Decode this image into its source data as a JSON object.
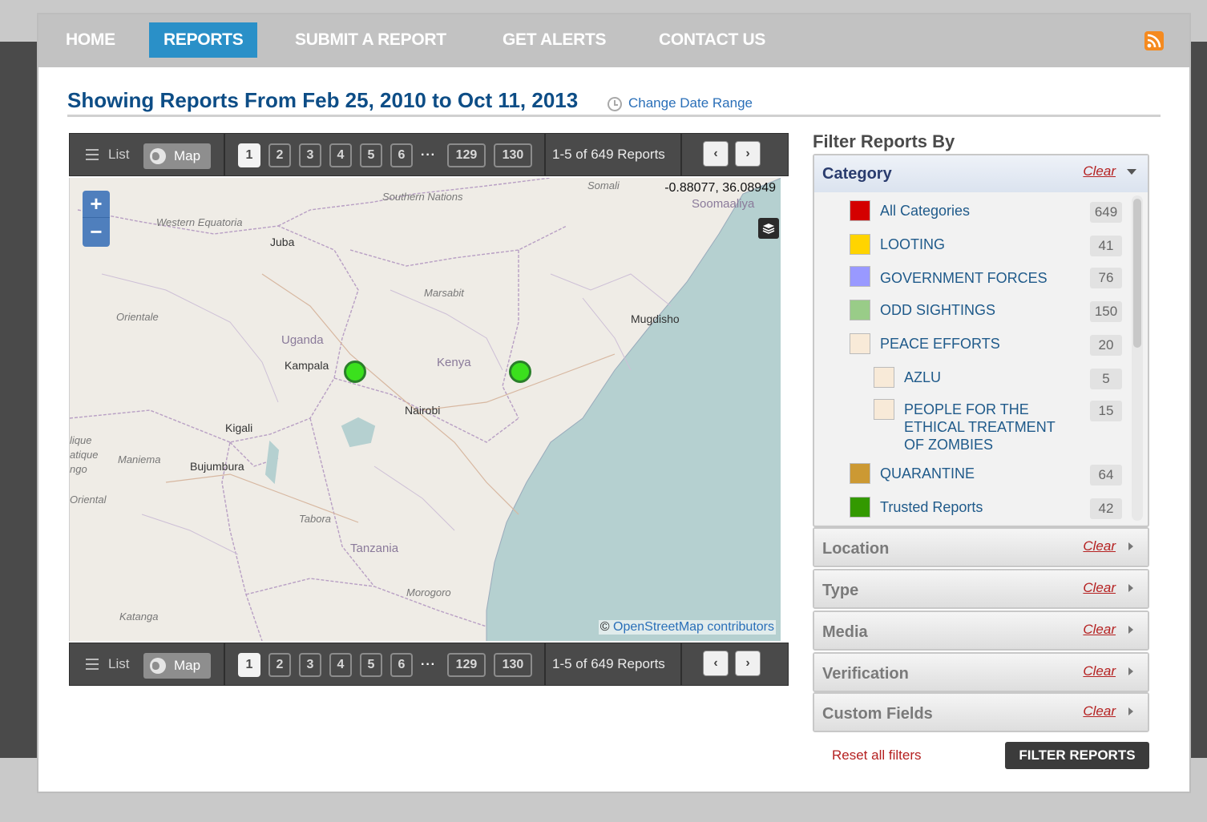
{
  "nav": {
    "items": [
      {
        "label": "HOME"
      },
      {
        "label": "REPORTS"
      },
      {
        "label": "SUBMIT A REPORT"
      },
      {
        "label": "GET ALERTS"
      },
      {
        "label": "CONTACT US"
      }
    ],
    "active": "REPORTS",
    "rss_icon": "rss-icon"
  },
  "heading": {
    "title": "Showing Reports From Feb 25, 2010 to Oct 11, 2013",
    "change_range": "Change Date Range"
  },
  "toolbar": {
    "list_label": "List",
    "map_label": "Map",
    "pages": [
      "1",
      "2",
      "3",
      "4",
      "5",
      "6"
    ],
    "ellipsis": "···",
    "last_pages": [
      "129",
      "130"
    ],
    "current_page": "1",
    "count_text": "1-5 of 649 Reports",
    "prev": "‹",
    "next": "›"
  },
  "map": {
    "zoom_in": "+",
    "zoom_out": "−",
    "coords": "-0.88077, 36.08949",
    "attribution_prefix": "©",
    "attribution_link": "OpenStreetMap contributors",
    "labels": [
      "Somali",
      "Southern Nations",
      "Soomaaliya",
      "Western Equatoria",
      "Juba",
      "Marsabit",
      "Orientale",
      "Uganda",
      "Mugdisho",
      "Kampala",
      "Kenya",
      "Nairobi",
      "Kigali",
      "lique",
      "atique",
      "ngo",
      "Maniema",
      "Bujumbura",
      "Oriental",
      "Tabora",
      "Tanzania",
      "Morogoro",
      "Katanga"
    ],
    "marker_color": "#3be01d",
    "water_color": "#b5d0d0"
  },
  "sidebar": {
    "title": "Filter Reports By",
    "category": {
      "title": "Category",
      "clear": "Clear",
      "items": [
        {
          "label": "All Categories",
          "count": "649",
          "color": "#d40000"
        },
        {
          "label": "LOOTING",
          "count": "41",
          "color": "#ffd400"
        },
        {
          "label": "GOVERNMENT FORCES",
          "count": "76",
          "color": "#9999ff"
        },
        {
          "label": "ODD SIGHTINGS",
          "count": "150",
          "color": "#99cc88"
        },
        {
          "label": "PEACE EFFORTS",
          "count": "20",
          "color": "#f8ead8"
        },
        {
          "label": "AZLU",
          "count": "5",
          "color": "#f8ead8"
        },
        {
          "label": "PEOPLE FOR THE ETHICAL TREATMENT OF ZOMBIES",
          "count": "15",
          "color": "#f8ead8"
        },
        {
          "label": "QUARANTINE",
          "count": "64",
          "color": "#cc9933"
        },
        {
          "label": "Trusted Reports",
          "count": "42",
          "color": "#339900"
        }
      ]
    },
    "panels": [
      {
        "title": "Location",
        "clear": "Clear"
      },
      {
        "title": "Type",
        "clear": "Clear"
      },
      {
        "title": "Media",
        "clear": "Clear"
      },
      {
        "title": "Verification",
        "clear": "Clear"
      },
      {
        "title": "Custom Fields",
        "clear": "Clear"
      }
    ],
    "reset": "Reset all filters",
    "filter_button": "FILTER REPORTS"
  }
}
